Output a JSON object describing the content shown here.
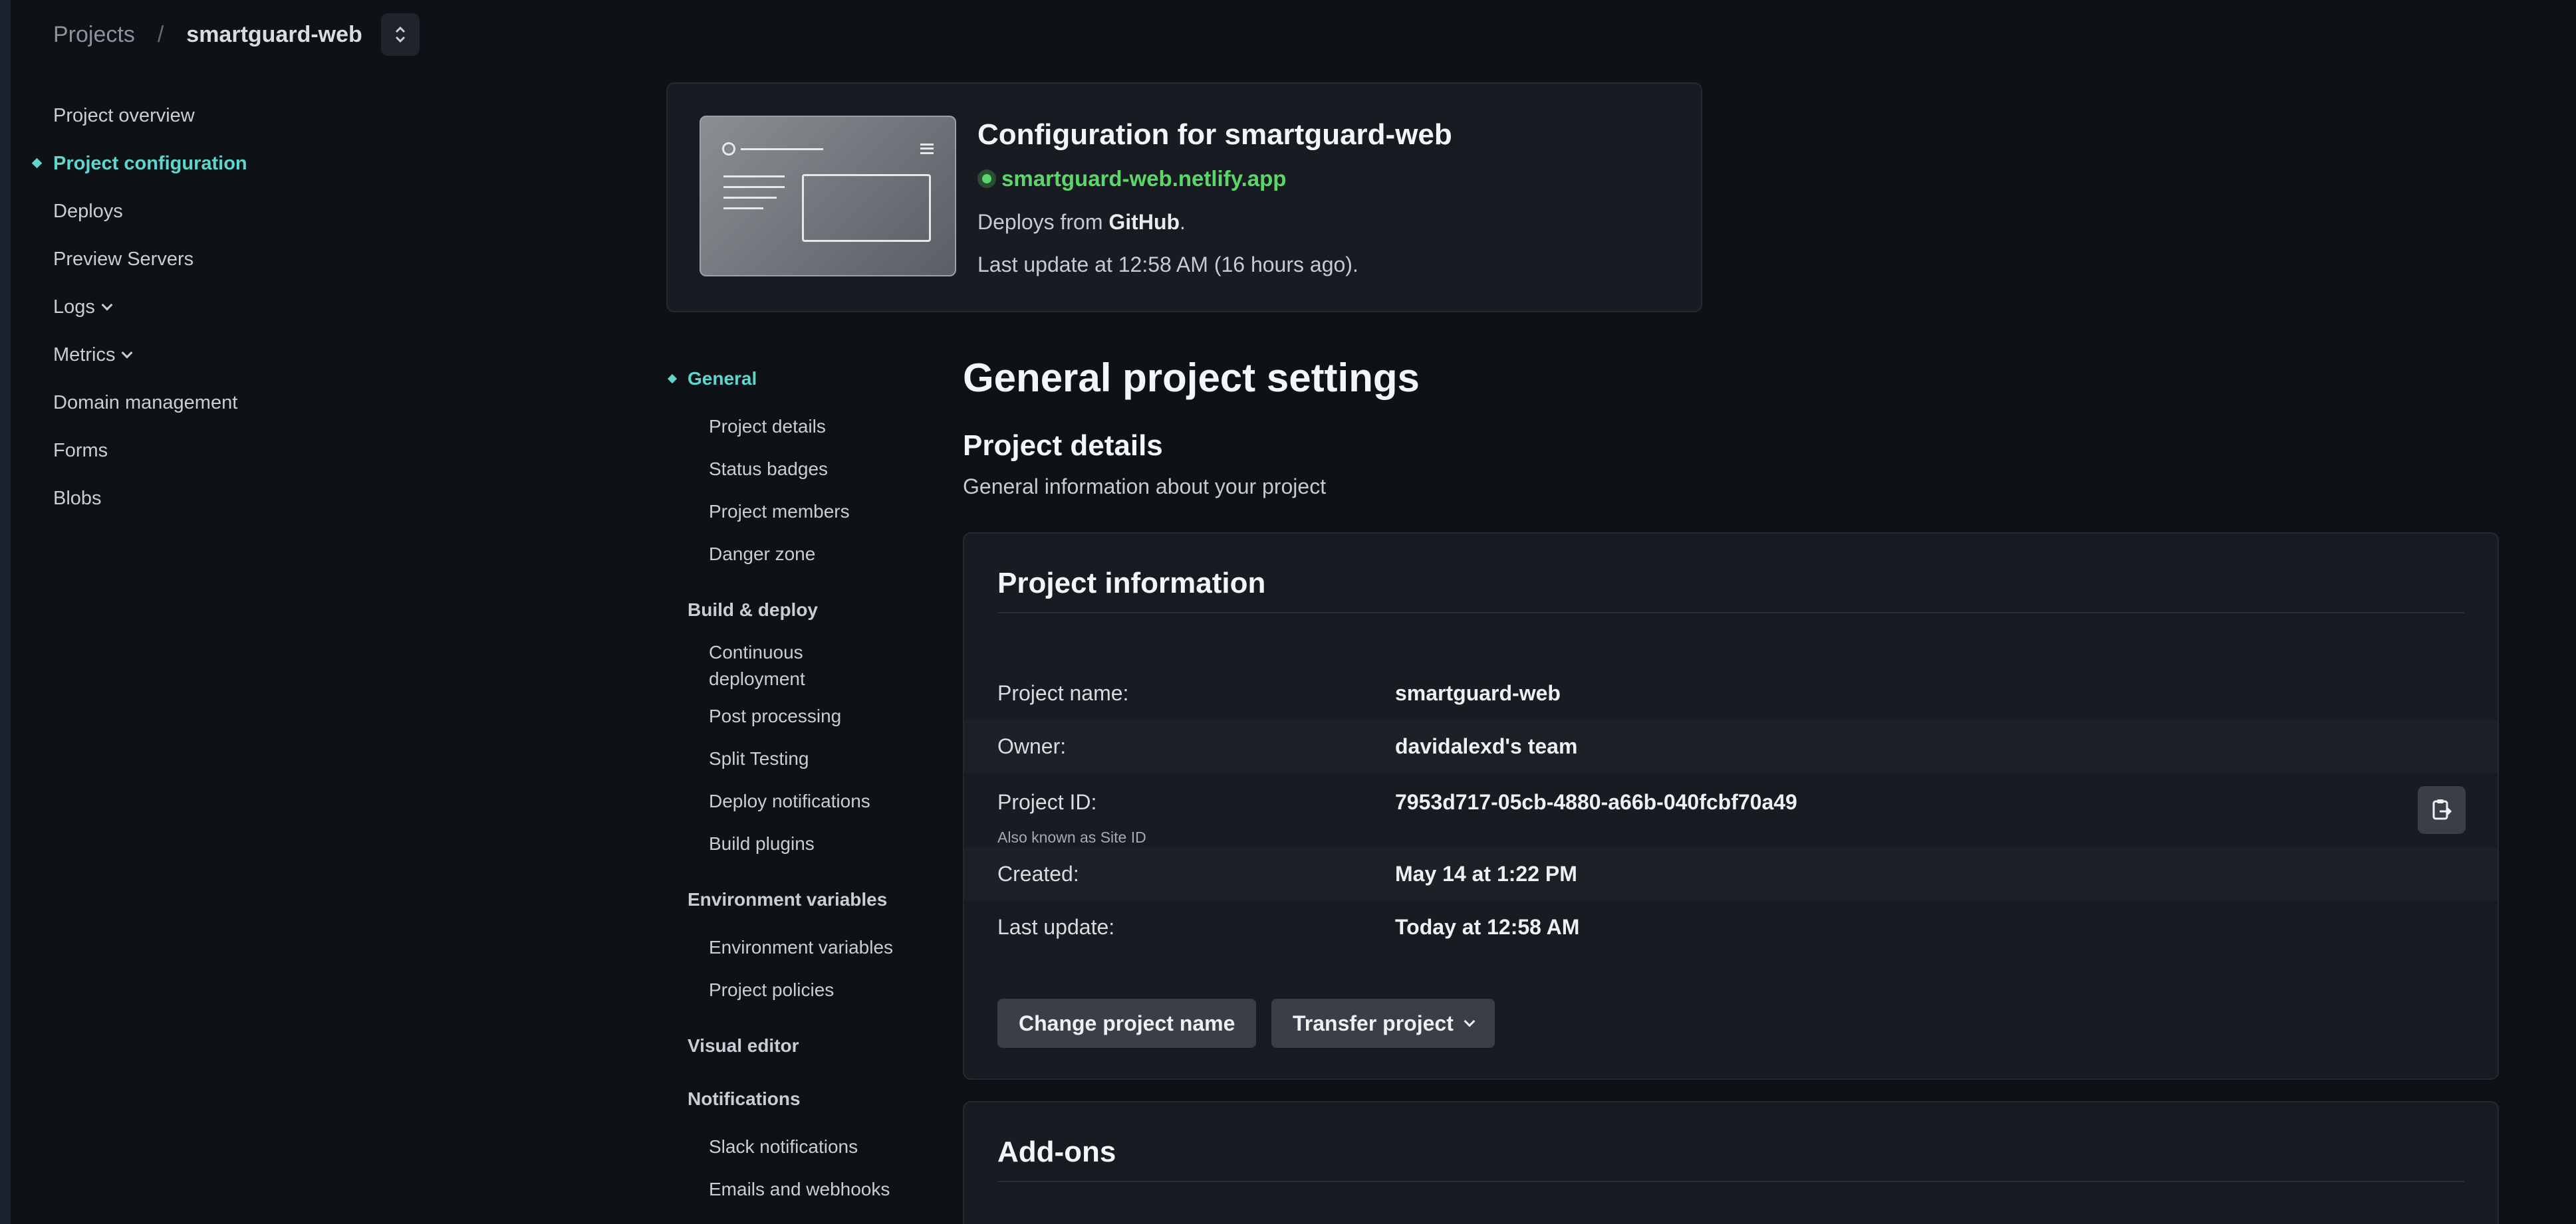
{
  "breadcrumb": {
    "projects": "Projects",
    "separator": "/",
    "site": "smartguard-web"
  },
  "sidebar": {
    "items": [
      {
        "label": "Project overview"
      },
      {
        "label": "Project configuration"
      },
      {
        "label": "Deploys"
      },
      {
        "label": "Preview Servers"
      },
      {
        "label": "Logs"
      },
      {
        "label": "Metrics"
      },
      {
        "label": "Domain management"
      },
      {
        "label": "Forms"
      },
      {
        "label": "Blobs"
      }
    ]
  },
  "config": {
    "title": "Configuration for smartguard-web",
    "url": "smartguard-web.netlify.app",
    "deploys_prefix": "Deploys from ",
    "deploys_source": "GitHub",
    "deploys_suffix": ".",
    "last_update": "Last update at 12:58 AM (16 hours ago).",
    "status_color": "#5bd76a"
  },
  "subnav": {
    "general": "General",
    "general_items": [
      "Project details",
      "Status badges",
      "Project members",
      "Danger zone"
    ],
    "build": "Build & deploy",
    "build_items": [
      "Continuous deployment",
      "Post processing",
      "Split Testing",
      "Deploy notifications",
      "Build plugins"
    ],
    "env": "Environment variables",
    "env_items": [
      "Environment variables",
      "Project policies"
    ],
    "visual": "Visual editor",
    "notifications": "Notifications",
    "notification_items": [
      "Slack notifications",
      "Emails and webhooks"
    ]
  },
  "main": {
    "heading": "General project settings",
    "section_title": "Project details",
    "section_desc": "General information about your project",
    "card_title": "Project information",
    "rows": {
      "name_label": "Project name:",
      "name_value": "smartguard-web",
      "owner_label": "Owner:",
      "owner_value": "davidalexd's team",
      "id_label": "Project ID:",
      "id_value": "7953d717-05cb-4880-a66b-040fcbf70a49",
      "id_sublabel": "Also known as Site ID",
      "created_label": "Created:",
      "created_value": "May 14 at 1:22 PM",
      "updated_label": "Last update:",
      "updated_value": "Today at 12:58 AM"
    },
    "change_name_button": "Change project name",
    "transfer_button": "Transfer project",
    "addons_title": "Add-ons"
  },
  "colors": {
    "accent": "#5fd6cc",
    "background": "#0e1116",
    "card": "#181c22"
  }
}
